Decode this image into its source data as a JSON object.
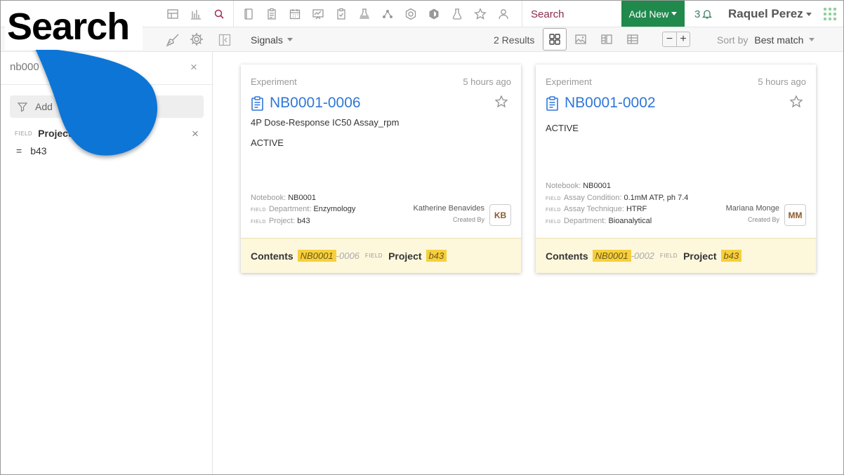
{
  "overlay": {
    "label": "Search"
  },
  "topbar": {
    "search_label": "Search",
    "add_new_label": "Add New",
    "notification_count": "3",
    "user_name": "Raquel Perez"
  },
  "left": {
    "query": "nb000",
    "add_filter_label": "Add",
    "filter": {
      "tag": "FIELD",
      "name": "Project",
      "operator": "=",
      "value": "b43"
    }
  },
  "subbar": {
    "signals_label": "Signals",
    "results_label": "2 Results",
    "sort_label": "Sort by",
    "sort_value": "Best match"
  },
  "cards": [
    {
      "type": "Experiment",
      "time": "5 hours ago",
      "title": "NB0001-0006",
      "line1": "4P Dose-Response IC50 Assay_rpm",
      "line2": "ACTIVE",
      "meta": [
        {
          "tag": "",
          "label": "Notebook:",
          "value": "NB0001"
        },
        {
          "tag": "FIELD",
          "label": "Department:",
          "value": "Enzymology"
        },
        {
          "tag": "FIELD",
          "label": "Project:",
          "value": "b43"
        }
      ],
      "creator": "Katherine Benavides",
      "created_by": "Created By",
      "initials": "KB",
      "footer": {
        "contents_label": "Contents",
        "hl1": "NB0001",
        "rest": "-0006",
        "field_tag": "FIELD",
        "project_label": "Project",
        "hl2": "b43"
      }
    },
    {
      "type": "Experiment",
      "time": "5 hours ago",
      "title": "NB0001-0002",
      "line1": "ACTIVE",
      "meta": [
        {
          "tag": "",
          "label": "Notebook:",
          "value": "NB0001"
        },
        {
          "tag": "FIELD",
          "label": "Assay Condition:",
          "value": "0.1mM ATP, ph 7.4"
        },
        {
          "tag": "FIELD",
          "label": "Assay Technique:",
          "value": "HTRF"
        },
        {
          "tag": "FIELD",
          "label": "Department:",
          "value": "Bioanalytical"
        }
      ],
      "creator": "Mariana Monge",
      "created_by": "Created By",
      "initials": "MM",
      "footer": {
        "contents_label": "Contents",
        "hl1": "NB0001",
        "rest": "-0002",
        "field_tag": "FIELD",
        "project_label": "Project",
        "hl2": "b43"
      }
    }
  ],
  "colors": {
    "accent_green": "#1f8a4c",
    "link_blue": "#2f77d8",
    "highlight": "#f7cf3c",
    "drop_blue": "#0a74d6"
  }
}
